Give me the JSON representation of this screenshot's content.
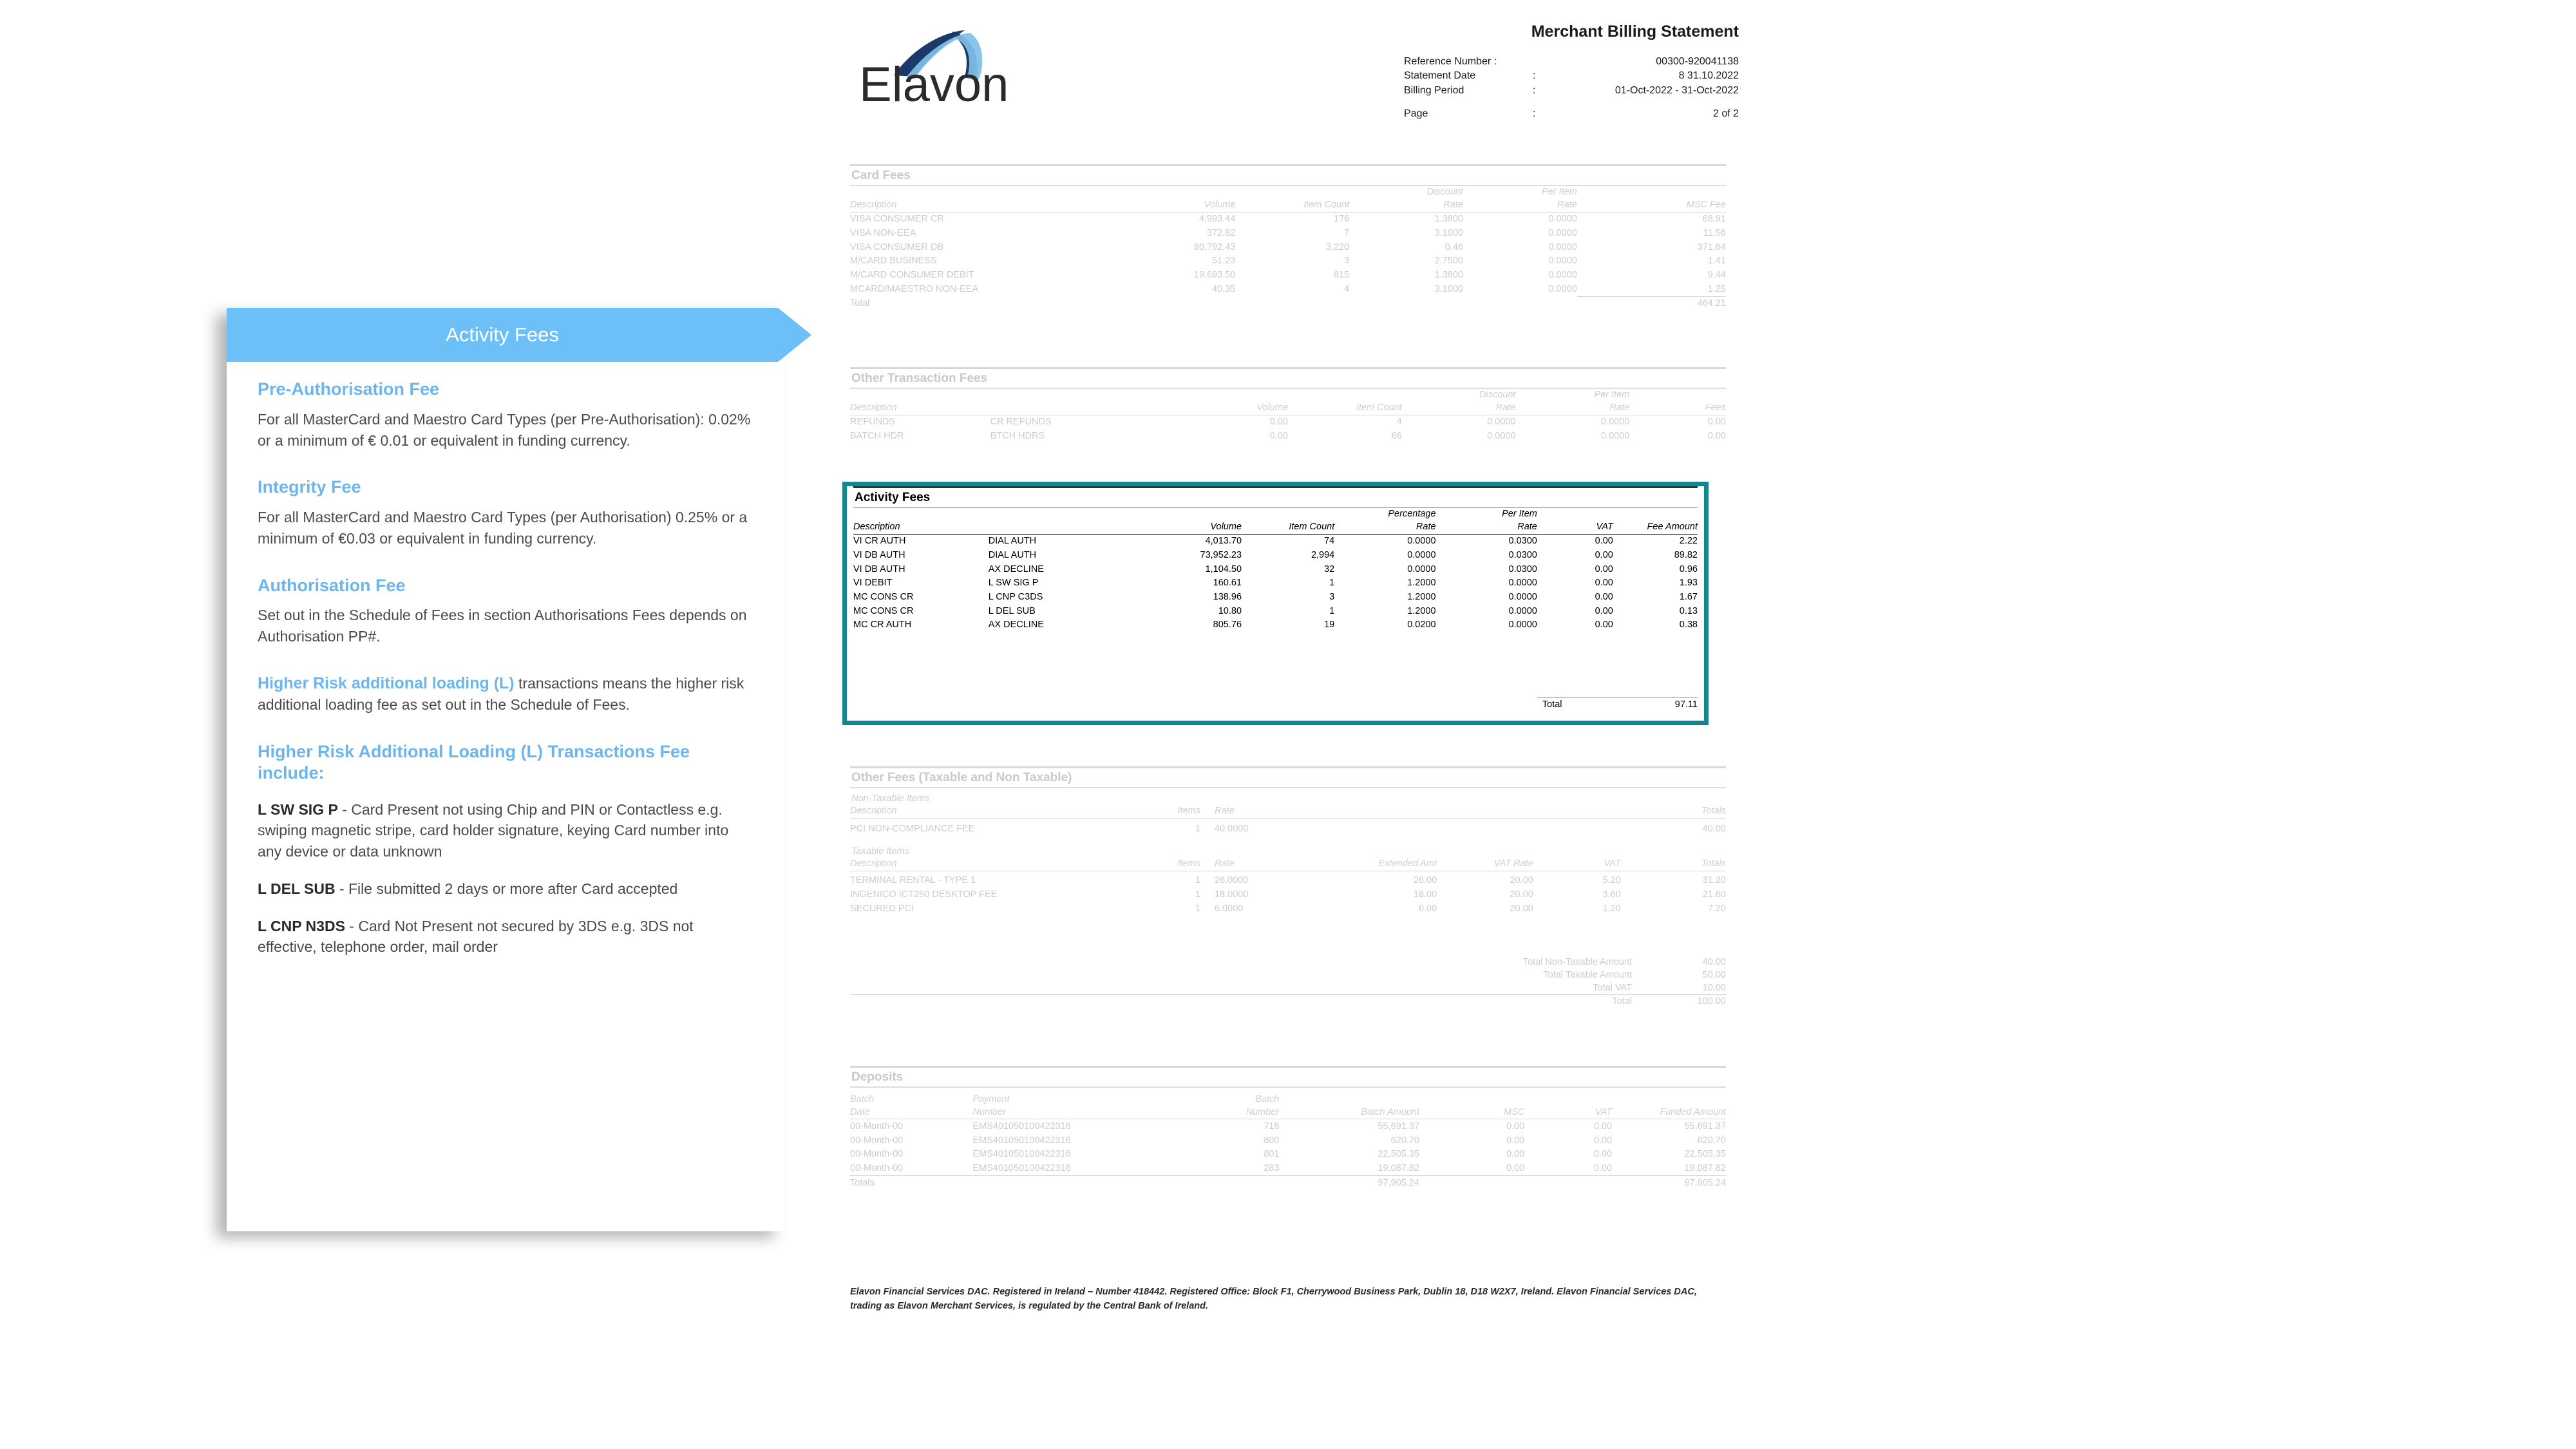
{
  "statement": {
    "logo_text": "Elavon",
    "title": "Merchant Billing Statement",
    "meta": [
      {
        "label": "Reference Number :",
        "colon": "",
        "value": "00300-920041138"
      },
      {
        "label": "Statement Date",
        "colon": ":",
        "value": "8 31.10.2022"
      },
      {
        "label": "Billing Period",
        "colon": ":",
        "value": "01-Oct-2022 - 31-Oct-2022"
      }
    ],
    "page_label": "Page",
    "page_colon": ":",
    "page_value": "2 of 2",
    "card_fees": {
      "title": "Card Fees",
      "headers": [
        "Description",
        "Volume",
        "Item Count",
        "Discount\nRate",
        "Per Item\nRate",
        "MSC Fee"
      ],
      "headers_top": [
        "",
        "",
        "",
        "Discount",
        "Per Item",
        ""
      ],
      "headers_bottom": [
        "Description",
        "Volume",
        "Item Count",
        "Rate",
        "Rate",
        "MSC Fee"
      ],
      "rows": [
        {
          "desc": "VISA CONSUMER CR",
          "volume": "4,993.44",
          "count": "176",
          "discount": "1.3800",
          "peritem": "0.0000",
          "fee": "68.91"
        },
        {
          "desc": "VISA NON-EEA",
          "volume": "372.82",
          "count": "7",
          "discount": "3.1000",
          "peritem": "0.0000",
          "fee": "11.56"
        },
        {
          "desc": "VISA CONSUMER DB",
          "volume": "80,792.43",
          "count": "3,220",
          "discount": "0.46",
          "peritem": "0.0000",
          "fee": "371.64"
        },
        {
          "desc": "M/CARD BUSINESS",
          "volume": "51.23",
          "count": "3",
          "discount": "2.7500",
          "peritem": "0.0000",
          "fee": "1.41"
        },
        {
          "desc": "M/CARD CONSUMER DEBIT",
          "volume": "19,693.50",
          "count": "815",
          "discount": "1.3800",
          "peritem": "0.0000",
          "fee": "9.44"
        },
        {
          "desc": "MCARD/MAESTRO NON-EEA",
          "volume": "40.35",
          "count": "4",
          "discount": "3.1000",
          "peritem": "0.0000",
          "fee": "1.25"
        }
      ],
      "total_label": "Total",
      "total_value": "464.21"
    },
    "other_transaction_fees": {
      "title": "Other Transaction Fees",
      "headers_top": [
        "",
        "",
        "",
        "",
        "Discount",
        "Per Item",
        ""
      ],
      "headers_bottom": [
        "Description",
        "",
        "Volume",
        "Item Count",
        "Rate",
        "Rate",
        "Fees"
      ],
      "rows": [
        {
          "desc": "REFUNDS",
          "desc2": "CR REFUNDS",
          "volume": "0.00",
          "count": "4",
          "discount": "0.0000",
          "peritem": "0.0000",
          "fee": "0.00"
        },
        {
          "desc": "BATCH HDR",
          "desc2": "BTCH HDRS",
          "volume": "0.00",
          "count": "66",
          "discount": "0.0000",
          "peritem": "0.0000",
          "fee": "0.00"
        }
      ]
    },
    "activity_fees": {
      "title": "Activity Fees",
      "headers_top": [
        "",
        "",
        "",
        "",
        "Percentage",
        "Per Item",
        "",
        ""
      ],
      "headers_bottom": [
        "Description",
        "",
        "Volume",
        "Item Count",
        "Rate",
        "Rate",
        "VAT",
        "Fee Amount"
      ],
      "rows": [
        {
          "desc": "VI CR AUTH",
          "desc2": "DIAL AUTH",
          "volume": "4,013.70",
          "count": "74",
          "pct": "0.0000",
          "peritem": "0.0300",
          "vat": "0.00",
          "fee": "2.22"
        },
        {
          "desc": "VI DB AUTH",
          "desc2": "DIAL AUTH",
          "volume": "73,952.23",
          "count": "2,994",
          "pct": "0.0000",
          "peritem": "0.0300",
          "vat": "0.00",
          "fee": "89.82"
        },
        {
          "desc": "VI DB AUTH",
          "desc2": "AX DECLINE",
          "volume": "1,104.50",
          "count": "32",
          "pct": "0.0000",
          "peritem": "0.0300",
          "vat": "0.00",
          "fee": "0.96"
        },
        {
          "desc": "VI DEBIT",
          "desc2": "L SW SIG P",
          "volume": "160.61",
          "count": "1",
          "pct": "1.2000",
          "peritem": "0.0000",
          "vat": "0.00",
          "fee": "1.93"
        },
        {
          "desc": "MC CONS CR",
          "desc2": "L CNP C3DS",
          "volume": "138.96",
          "count": "3",
          "pct": "1.2000",
          "peritem": "0.0000",
          "vat": "0.00",
          "fee": "1.67"
        },
        {
          "desc": "MC CONS CR",
          "desc2": "L DEL SUB",
          "volume": "10.80",
          "count": "1",
          "pct": "1.2000",
          "peritem": "0.0000",
          "vat": "0.00",
          "fee": "0.13"
        },
        {
          "desc": "MC CR AUTH",
          "desc2": "AX DECLINE",
          "volume": "805.76",
          "count": "19",
          "pct": "0.0200",
          "peritem": "0.0000",
          "vat": "0.00",
          "fee": "0.38"
        }
      ],
      "total_label": "Total",
      "total_value": "97.11"
    },
    "other_fees": {
      "title": "Other Fees (Taxable and Non Taxable)",
      "nontaxable_label": "Non-Taxable Items",
      "nontaxable_headers": [
        "Description",
        "Items",
        "Rate",
        "",
        "",
        "",
        "Totals"
      ],
      "nontaxable_rows": [
        {
          "desc": "PCI NON-COMPLIANCE FEE",
          "items": "1",
          "rate": "40.0000",
          "total": "40.00"
        }
      ],
      "taxable_label": "Taxable Items",
      "taxable_headers": [
        "Description",
        "Items",
        "Rate",
        "Extended Amt",
        "VAT Rate",
        "VAT",
        "Totals"
      ],
      "taxable_rows": [
        {
          "desc": "TERMINAL RENTAL - TYPE 1",
          "items": "1",
          "rate": "26.0000",
          "ext": "26.00",
          "vatrate": "20.00",
          "vat": "5.20",
          "total": "31.20"
        },
        {
          "desc": "INGENICO ICT250 DESKTOP FEE",
          "items": "1",
          "rate": "18.0000",
          "ext": "18.00",
          "vatrate": "20.00",
          "vat": "3.60",
          "total": "21.60"
        },
        {
          "desc": "SECURED PCI",
          "items": "1",
          "rate": "6.0000",
          "ext": "6.00",
          "vatrate": "20.00",
          "vat": "1.20",
          "total": "7.20"
        }
      ],
      "totals": [
        {
          "label": "Total Non-Taxable Amount",
          "value": "40.00"
        },
        {
          "label": "Total Taxable Amount",
          "value": "50.00"
        },
        {
          "label": "Total VAT",
          "value": "10.00"
        },
        {
          "label": "Total",
          "value": "100.00"
        }
      ]
    },
    "deposits": {
      "title": "Deposits",
      "headers_top": [
        "Batch",
        "Payment",
        "Batch",
        "",
        "",
        "",
        ""
      ],
      "headers_bottom": [
        "Date",
        "Number",
        "Number",
        "Batch Amount",
        "MSC",
        "VAT",
        "Funded Amount"
      ],
      "rows": [
        {
          "date": "00-Month-00",
          "payment": "EMS401050100422316",
          "batch": "718",
          "amount": "55,691.37",
          "msc": "0.00",
          "vat": "0.00",
          "funded": "55,691.37"
        },
        {
          "date": "00-Month-00",
          "payment": "EMS401050100422316",
          "batch": "800",
          "amount": "620.70",
          "msc": "0.00",
          "vat": "0.00",
          "funded": "620.70"
        },
        {
          "date": "00-Month-00",
          "payment": "EMS401050100422316",
          "batch": "801",
          "amount": "22,505.35",
          "msc": "0.00",
          "vat": "0.00",
          "funded": "22,505.35"
        },
        {
          "date": "00-Month-00",
          "payment": "EMS401050100422316",
          "batch": "283",
          "amount": "19,087.82",
          "msc": "0.00",
          "vat": "0.00",
          "funded": "19,087.82"
        }
      ],
      "totals_label": "Totals",
      "totals_amount": "97,905.24",
      "totals_funded": "97,905.24"
    },
    "footer": "Elavon Financial Services DAC. Registered in Ireland – Number 418442. Registered Office: Block F1, Cherrywood Business Park, Dublin 18, D18 W2X7, Ireland. Elavon Financial Services DAC, trading as Elavon Merchant Services, is regulated by the Central Bank of Ireland."
  },
  "callout": {
    "banner_title": "Activity Fees",
    "sections": [
      {
        "heading": "Pre-Authorisation Fee",
        "body": "For all MasterCard and Maestro Card Types (per Pre-Authorisation): 0.02% or a minimum of € 0.01 or equivalent in funding currency."
      },
      {
        "heading": "Integrity Fee",
        "body": "For all MasterCard and Maestro Card Types (per Authorisation) 0.25% or a minimum of €0.03 or equivalent in funding currency."
      },
      {
        "heading": "Authorisation Fee",
        "body": "Set out in the Schedule of Fees in section Authorisations Fees depends on Authorisation PP#."
      }
    ],
    "mixed_paragraph": {
      "accent": "Higher Risk additional loading (L)",
      "rest": " transactions means the higher risk additional loading fee as set out in the Schedule of Fees."
    },
    "list_heading": "Higher Risk Additional Loading (L) Transactions Fee include:",
    "bullets": [
      {
        "code": "L SW SIG P",
        "text": " - Card Present not using Chip and PIN or Contactless e.g. swiping magnetic stripe, card holder signature, keying Card number into any device or data unknown"
      },
      {
        "code": "L DEL SUB",
        "text": " - File submitted 2 days or more after Card accepted"
      },
      {
        "code": "L CNP N3DS",
        "text": " - Card Not Present not secured by 3DS e.g.  3DS not effective, telephone order, mail order"
      }
    ]
  },
  "colors": {
    "banner_blue": "#6cc0f7",
    "heading_blue": "#6cb6ec",
    "highlight_teal": "#13868f",
    "faded_gray": "#c9c9c9"
  }
}
